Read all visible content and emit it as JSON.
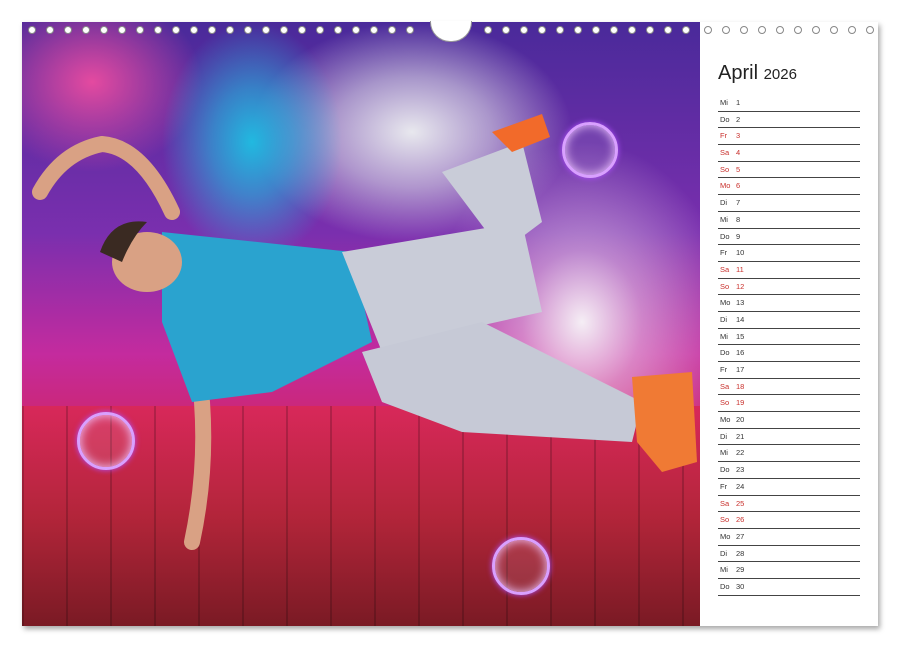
{
  "calendar": {
    "month": "April",
    "year": "2026",
    "days": [
      {
        "dow": "Mi",
        "day": "1",
        "weekend": false
      },
      {
        "dow": "Do",
        "day": "2",
        "weekend": false
      },
      {
        "dow": "Fr",
        "day": "3",
        "weekend": true
      },
      {
        "dow": "Sa",
        "day": "4",
        "weekend": true
      },
      {
        "dow": "So",
        "day": "5",
        "weekend": true
      },
      {
        "dow": "Mo",
        "day": "6",
        "weekend": true
      },
      {
        "dow": "Di",
        "day": "7",
        "weekend": false
      },
      {
        "dow": "Mi",
        "day": "8",
        "weekend": false
      },
      {
        "dow": "Do",
        "day": "9",
        "weekend": false
      },
      {
        "dow": "Fr",
        "day": "10",
        "weekend": false
      },
      {
        "dow": "Sa",
        "day": "11",
        "weekend": true
      },
      {
        "dow": "So",
        "day": "12",
        "weekend": true
      },
      {
        "dow": "Mo",
        "day": "13",
        "weekend": false
      },
      {
        "dow": "Di",
        "day": "14",
        "weekend": false
      },
      {
        "dow": "Mi",
        "day": "15",
        "weekend": false
      },
      {
        "dow": "Do",
        "day": "16",
        "weekend": false
      },
      {
        "dow": "Fr",
        "day": "17",
        "weekend": false
      },
      {
        "dow": "Sa",
        "day": "18",
        "weekend": true
      },
      {
        "dow": "So",
        "day": "19",
        "weekend": true
      },
      {
        "dow": "Mo",
        "day": "20",
        "weekend": false
      },
      {
        "dow": "Di",
        "day": "21",
        "weekend": false
      },
      {
        "dow": "Mi",
        "day": "22",
        "weekend": false
      },
      {
        "dow": "Do",
        "day": "23",
        "weekend": false
      },
      {
        "dow": "Fr",
        "day": "24",
        "weekend": false
      },
      {
        "dow": "Sa",
        "day": "25",
        "weekend": true
      },
      {
        "dow": "So",
        "day": "26",
        "weekend": true
      },
      {
        "dow": "Mo",
        "day": "27",
        "weekend": false
      },
      {
        "dow": "Di",
        "day": "28",
        "weekend": false
      },
      {
        "dow": "Mi",
        "day": "29",
        "weekend": false
      },
      {
        "dow": "Do",
        "day": "30",
        "weekend": false
      }
    ]
  },
  "colors": {
    "weekend": "#c9302c",
    "text": "#333333"
  }
}
